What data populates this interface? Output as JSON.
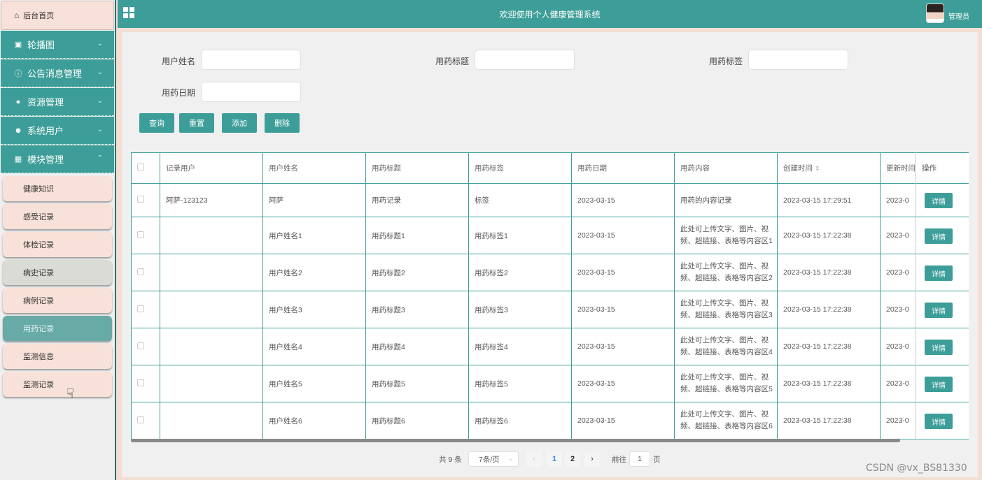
{
  "header": {
    "title": "欢迎使用个人健康管理系统",
    "user_label": "管理员"
  },
  "sidebar": {
    "home": "后台首页",
    "menus": [
      {
        "label": "轮播图",
        "icon": "image-icon",
        "expanded": false
      },
      {
        "label": "公告消息管理",
        "icon": "info-icon",
        "expanded": false
      },
      {
        "label": "资源管理",
        "icon": "location-icon",
        "expanded": false
      },
      {
        "label": "系统用户",
        "icon": "user-icon",
        "expanded": false
      },
      {
        "label": "模块管理",
        "icon": "grid-icon",
        "expanded": true
      }
    ],
    "submenu": [
      "健康知识",
      "感受记录",
      "体检记录",
      "病史记录",
      "病例记录",
      "用药记录",
      "监测信息",
      "监测记录"
    ],
    "active_submenu": "用药记录"
  },
  "search": {
    "fields": [
      {
        "label": "用户姓名",
        "value": ""
      },
      {
        "label": "用药标题",
        "value": ""
      },
      {
        "label": "用药标签",
        "value": ""
      },
      {
        "label": "用药日期",
        "value": ""
      }
    ],
    "buttons": [
      "查询",
      "重置",
      "添加",
      "删除"
    ]
  },
  "table": {
    "columns": [
      "记录用户",
      "用户姓名",
      "用药标题",
      "用药标签",
      "用药日期",
      "用药内容",
      "创建时间",
      "更新时间",
      "操作"
    ],
    "rows": [
      {
        "user": "阿萨-123123",
        "name": "阿萨",
        "title": "用药记录",
        "tag": "标签",
        "date": "2023-03-15",
        "content": "用药的内容记录",
        "created": "2023-03-15 17:29:51",
        "updated": "2023-0"
      },
      {
        "user": "",
        "name": "用户姓名1",
        "title": "用药标题1",
        "tag": "用药标签1",
        "date": "2023-03-15",
        "content": "此处可上传文字、图片、视频、超链接、表格等内容区1",
        "created": "2023-03-15 17:22:38",
        "updated": "2023-0"
      },
      {
        "user": "",
        "name": "用户姓名2",
        "title": "用药标题2",
        "tag": "用药标签2",
        "date": "2023-03-15",
        "content": "此处可上传文字、图片、视频、超链接、表格等内容区2",
        "created": "2023-03-15 17:22:38",
        "updated": "2023-0"
      },
      {
        "user": "",
        "name": "用户姓名3",
        "title": "用药标题3",
        "tag": "用药标签3",
        "date": "2023-03-15",
        "content": "此处可上传文字、图片、视频、超链接、表格等内容区3",
        "created": "2023-03-15 17:22:38",
        "updated": "2023-0"
      },
      {
        "user": "",
        "name": "用户姓名4",
        "title": "用药标题4",
        "tag": "用药标签4",
        "date": "2023-03-15",
        "content": "此处可上传文字、图片、视频、超链接、表格等内容区4",
        "created": "2023-03-15 17:22:38",
        "updated": "2023-0"
      },
      {
        "user": "",
        "name": "用户姓名5",
        "title": "用药标题5",
        "tag": "用药标签5",
        "date": "2023-03-15",
        "content": "此处可上传文字、图片、视频、超链接、表格等内容区5",
        "created": "2023-03-15 17:22:38",
        "updated": "2023-0"
      },
      {
        "user": "",
        "name": "用户姓名6",
        "title": "用药标题6",
        "tag": "用药标签6",
        "date": "2023-03-15",
        "content": "此处可上传文字、图片、视频、超链接、表格等内容区6",
        "created": "2023-03-15 17:22:38",
        "updated": "2023-0"
      }
    ],
    "detail_label": "详情"
  },
  "pagination": {
    "total": "共 9 条",
    "page_size": "7条/页",
    "pages": [
      "1",
      "2"
    ],
    "current": "1",
    "goto_label": "前往",
    "goto_value": "1",
    "unit": "页"
  },
  "watermark": "CSDN @vx_BS81330",
  "colors": {
    "primary": "#3d9e99",
    "sidebar_sub": "#f7e1d8",
    "active_sub": "#67aaa6"
  }
}
